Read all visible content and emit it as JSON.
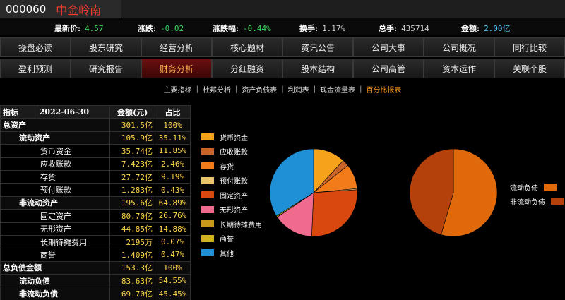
{
  "stock": {
    "code": "000060",
    "name": "中金岭南"
  },
  "quote": [
    {
      "label": "最新价:",
      "value": "4.57",
      "color": "#3cd85a"
    },
    {
      "label": "涨跌:",
      "value": "-0.02",
      "color": "#3cd85a"
    },
    {
      "label": "涨跌幅:",
      "value": "-0.44%",
      "color": "#3cd85a"
    },
    {
      "label": "换手:",
      "value": "1.17%",
      "color": "#cccccc"
    },
    {
      "label": "总手:",
      "value": "435714",
      "color": "#cccccc"
    },
    {
      "label": "金额:",
      "value": "2.00亿",
      "color": "#4fc3f7"
    }
  ],
  "nav_row1": [
    "操盘必读",
    "股东研究",
    "经营分析",
    "核心题材",
    "资讯公告",
    "公司大事",
    "公司概况",
    "同行比较"
  ],
  "nav_row2": [
    "盈利预测",
    "研究报告",
    "财务分析",
    "分红融资",
    "股本结构",
    "公司高管",
    "资本运作",
    "关联个股"
  ],
  "active_nav": "财务分析",
  "subnav": [
    "主要指标",
    "杜邦分析",
    "资产负债表",
    "利润表",
    "现金流量表",
    "百分比报表"
  ],
  "active_subnav": "百分比报表",
  "table": {
    "headers": [
      "指标",
      "2022-06-30",
      "金额(元)",
      "占比"
    ],
    "rows": [
      {
        "level": 0,
        "name": "总资产",
        "amount": "301.5亿",
        "pct": "100%"
      },
      {
        "level": 1,
        "name": "流动资产",
        "amount": "105.9亿",
        "pct": "35.11%"
      },
      {
        "level": 2,
        "name": "货币资金",
        "amount": "35.74亿",
        "pct": "11.85%"
      },
      {
        "level": 2,
        "name": "应收账款",
        "amount": "7.423亿",
        "pct": "2.46%"
      },
      {
        "level": 2,
        "name": "存货",
        "amount": "27.72亿",
        "pct": "9.19%"
      },
      {
        "level": 2,
        "name": "预付账款",
        "amount": "1.283亿",
        "pct": "0.43%"
      },
      {
        "level": 1,
        "name": "非流动资产",
        "amount": "195.6亿",
        "pct": "64.89%"
      },
      {
        "level": 2,
        "name": "固定资产",
        "amount": "80.70亿",
        "pct": "26.76%"
      },
      {
        "level": 2,
        "name": "无形资产",
        "amount": "44.85亿",
        "pct": "14.88%"
      },
      {
        "level": 2,
        "name": "长期待摊费用",
        "amount": "2195万",
        "pct": "0.07%"
      },
      {
        "level": 2,
        "name": "商誉",
        "amount": "1.409亿",
        "pct": "0.47%"
      },
      {
        "level": 0,
        "name": "总负债金额",
        "amount": "153.3亿",
        "pct": "100%"
      },
      {
        "level": 1,
        "name": "流动负债",
        "amount": "83.63亿",
        "pct": "54.55%"
      },
      {
        "level": 1,
        "name": "非流动负债",
        "amount": "69.70亿",
        "pct": "45.45%"
      }
    ]
  },
  "chart_data": [
    {
      "type": "pie",
      "labels": [
        "货币资金",
        "应收账款",
        "存货",
        "预付账款",
        "固定资产",
        "无形资产",
        "长期待摊费用",
        "商誉",
        "其他"
      ],
      "values": [
        11.85,
        2.46,
        9.19,
        0.43,
        26.76,
        14.88,
        0.07,
        0.47,
        33.89
      ],
      "colors": [
        "#f7a21b",
        "#c8642a",
        "#f37c1a",
        "#e9c46a",
        "#d9480f",
        "#ef6a8c",
        "#c79a1a",
        "#d4b01e",
        "#1f8fd6"
      ],
      "legend_position": "left"
    },
    {
      "type": "pie",
      "labels": [
        "流动负债",
        "非流动负债"
      ],
      "values": [
        54.55,
        45.45
      ],
      "colors": [
        "#e06a0b",
        "#b4400b"
      ],
      "legend_position": "right"
    }
  ]
}
